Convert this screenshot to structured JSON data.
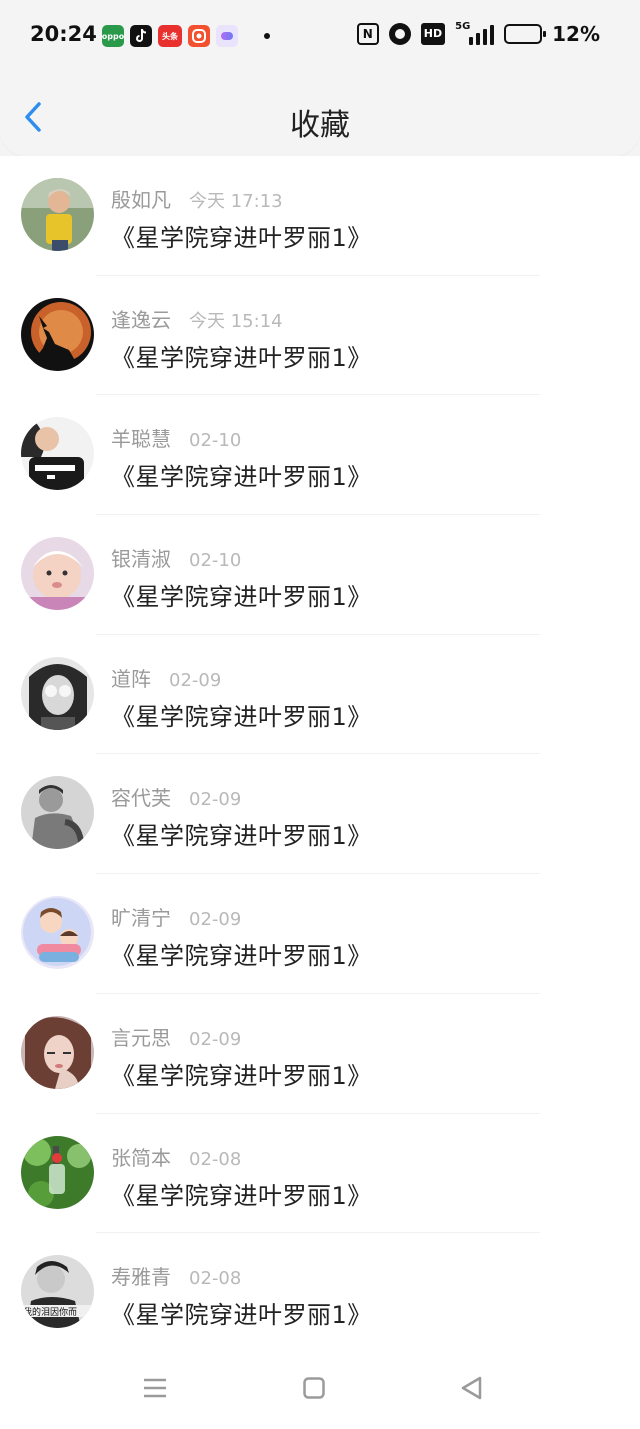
{
  "status_bar": {
    "time": "20:24",
    "notification_apps": [
      "oppo-app-icon",
      "tiktok-icon",
      "toutiao-icon",
      "orange-app-icon",
      "purple-app-icon"
    ],
    "oppo_label": "oppo",
    "toutiao_label": "头条",
    "nfc_label": "N",
    "hd_label": "HD",
    "network_label": "5G",
    "battery_percent": "12%",
    "battery_level": 0.12,
    "battery_color": "#f2b613"
  },
  "header": {
    "title": "收藏",
    "back_color": "#2e8ef0"
  },
  "favorites": [
    {
      "name": "殷如凡",
      "date": "今天 17:13",
      "book": "《星学院穿进叶罗丽1》",
      "avatar": "boy-yellow-shirt"
    },
    {
      "name": "逢逸云",
      "date": "今天 15:14",
      "book": "《星学院穿进叶罗丽1》",
      "avatar": "wolf-moon"
    },
    {
      "name": "羊聪慧",
      "date": "02-10",
      "book": "《星学院穿进叶罗丽1》",
      "avatar": "captain-shirt"
    },
    {
      "name": "银清淑",
      "date": "02-10",
      "book": "《星学院穿进叶罗丽1》",
      "avatar": "baby"
    },
    {
      "name": "道阵",
      "date": "02-09",
      "book": "《星学院穿进叶罗丽1》",
      "avatar": "girl-bw"
    },
    {
      "name": "容代芙",
      "date": "02-09",
      "book": "《星学院穿进叶罗丽1》",
      "avatar": "man-bw"
    },
    {
      "name": "旷清宁",
      "date": "02-09",
      "book": "《星学院穿进叶罗丽1》",
      "avatar": "cartoon-couple"
    },
    {
      "name": "言元思",
      "date": "02-09",
      "book": "《星学院穿进叶罗丽1》",
      "avatar": "girl-brown-hair"
    },
    {
      "name": "张简本",
      "date": "02-08",
      "book": "《星学院穿进叶罗丽1》",
      "avatar": "green-bottle"
    },
    {
      "name": "寿雅青",
      "date": "02-08",
      "book": "《星学院穿进叶罗丽1》",
      "avatar": "man-caption"
    }
  ],
  "avatar_caption": "我的泪因你而",
  "nav_bar": {
    "buttons": [
      "menu-icon",
      "home-icon",
      "back-triangle-icon"
    ]
  }
}
